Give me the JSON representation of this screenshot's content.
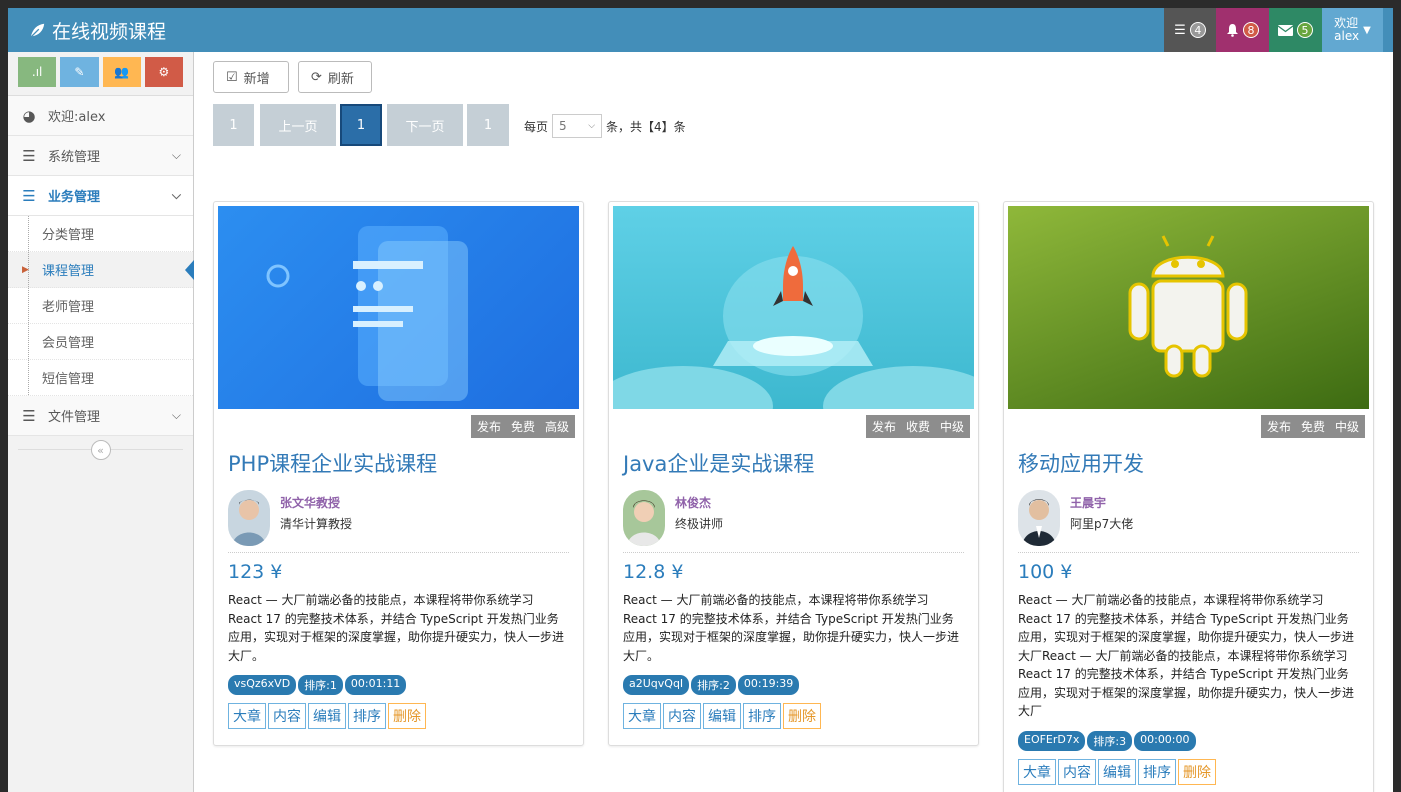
{
  "app": {
    "brand": "在线视频课程"
  },
  "navbar": {
    "tasks_count": "4",
    "notifications_count": "8",
    "messages_count": "5",
    "user_greeting": "欢迎",
    "user_name": "alex"
  },
  "sidebar": {
    "welcome": "欢迎:alex",
    "menu": [
      {
        "label": "系统管理"
      },
      {
        "label": "业务管理"
      },
      {
        "label": "文件管理"
      }
    ],
    "submenu": [
      {
        "label": "分类管理"
      },
      {
        "label": "课程管理"
      },
      {
        "label": "老师管理"
      },
      {
        "label": "会员管理"
      },
      {
        "label": "短信管理"
      }
    ]
  },
  "toolbar": {
    "add_label": "新增",
    "refresh_label": "刷新"
  },
  "pager": {
    "first": "1",
    "prev": "上一页",
    "current": "1",
    "next": "下一页",
    "last": "1",
    "per_page_label": "每页",
    "page_size": "5",
    "total_text": "条，共【4】条"
  },
  "courses": [
    {
      "status": "发布",
      "charge": "免费",
      "level": "高级",
      "title": "PHP课程企业实战课程",
      "teacher_name": "张文华教授",
      "teacher_title": "清华计算教授",
      "price": "123 ¥",
      "desc": "React — 大厂前端必备的技能点，本课程将带你系统学习 React 17 的完整技术体系，并结合 TypeScript 开发热门业务应用，实现对于框架的深度掌握，助你提升硬实力，快人一步进大厂。",
      "id": "vsQz6xVD",
      "sort": "排序:1",
      "duration": "00:01:11"
    },
    {
      "status": "发布",
      "charge": "收费",
      "level": "中级",
      "title": "Java企业是实战课程",
      "teacher_name": "林俊杰",
      "teacher_title": "终极讲师",
      "price": "12.8 ¥",
      "desc": "React — 大厂前端必备的技能点，本课程将带你系统学习 React 17 的完整技术体系，并结合 TypeScript 开发热门业务应用，实现对于框架的深度掌握，助你提升硬实力，快人一步进大厂。",
      "id": "a2UqvQqI",
      "sort": "排序:2",
      "duration": "00:19:39"
    },
    {
      "status": "发布",
      "charge": "免费",
      "level": "中级",
      "title": "移动应用开发",
      "teacher_name": "王晨宇",
      "teacher_title": "阿里p7大佬",
      "price": "100 ¥",
      "desc": "React — 大厂前端必备的技能点，本课程将带你系统学习 React 17 的完整技术体系，并结合 TypeScript 开发热门业务应用，实现对于框架的深度掌握，助你提升硬实力，快人一步进大厂React — 大厂前端必备的技能点，本课程将带你系统学习 React 17 的完整技术体系，并结合 TypeScript 开发热门业务应用，实现对于框架的深度掌握，助你提升硬实力，快人一步进大厂",
      "id": "EOFErD7x",
      "sort": "排序:3",
      "duration": "00:00:00"
    }
  ],
  "card_actions": {
    "chapter": "大章",
    "content": "内容",
    "edit": "编辑",
    "sort": "排序",
    "delete": "删除"
  },
  "colors": {
    "navbar": "#438eb9",
    "accent": "#2b7dbc",
    "danger": "#e59729"
  }
}
